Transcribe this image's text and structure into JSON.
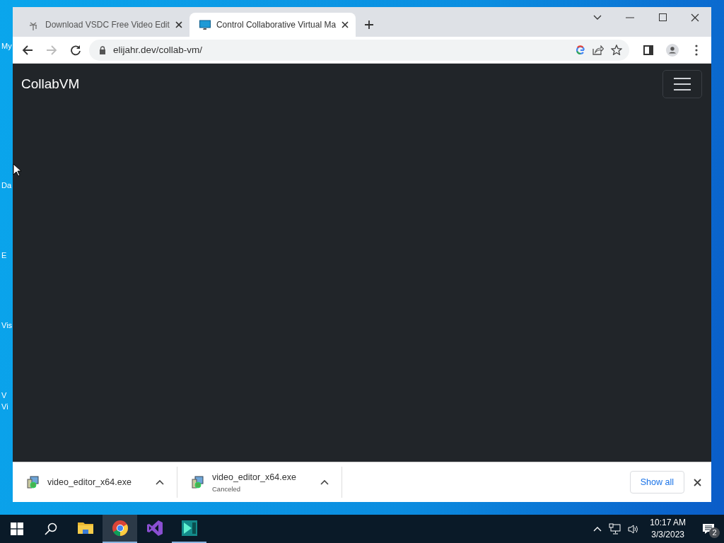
{
  "desktop": {
    "icon_labels": [
      "My",
      "Da",
      "E",
      "Vis",
      "V",
      "Vi"
    ]
  },
  "browser": {
    "tabs": [
      {
        "title": "Download VSDC Free Video Edit",
        "kind": "palm",
        "selected": false
      },
      {
        "title": "Control Collaborative Virtual Ma",
        "kind": "monitor",
        "selected": true
      }
    ],
    "address": "elijahr.dev/collab-vm/",
    "page": {
      "brand": "CollabVM"
    },
    "downloads": [
      {
        "filename": "video_editor_x64.exe"
      },
      {
        "filename": "video_editor_x64.exe",
        "status": "Canceled"
      }
    ],
    "show_all": "Show all"
  },
  "taskbar": {
    "apps": [
      {
        "kind": "folder",
        "selected": false,
        "running": false
      },
      {
        "kind": "chrome",
        "selected": true,
        "running": true
      },
      {
        "kind": "vs",
        "selected": false,
        "running": false
      },
      {
        "kind": "vsdc",
        "selected": false,
        "running": true
      }
    ],
    "time": "10:17 AM",
    "date": "3/3/2023",
    "notifications": "2"
  }
}
